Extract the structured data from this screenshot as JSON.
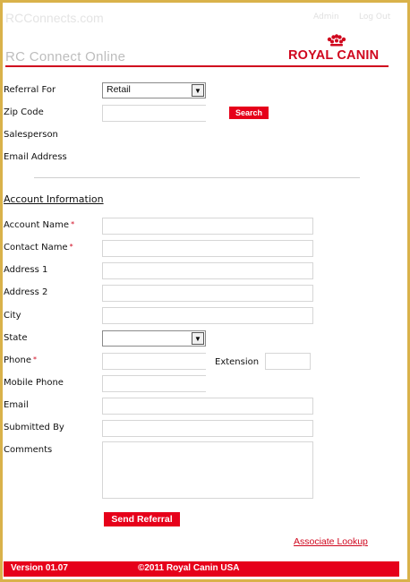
{
  "top": {
    "site_name": "RCConnects.com",
    "links": [
      "Admin",
      "Log Out"
    ]
  },
  "header": {
    "title": "RC Connect Online",
    "logo_text": "ROYAL CANIN"
  },
  "referral": {
    "referral_for_label": "Referral For",
    "referral_for_value": "Retail",
    "zip_label": "Zip Code",
    "zip_value": "",
    "search_button": "Search",
    "salesperson_label": "Salesperson",
    "email_address_label": "Email Address"
  },
  "account": {
    "section_title": "Account Information",
    "required_mark": "*",
    "account_name_label": "Account Name",
    "contact_name_label": "Contact Name",
    "address1_label": "Address 1",
    "address2_label": "Address 2",
    "city_label": "City",
    "state_label": "State",
    "state_value": "",
    "phone_label": "Phone",
    "extension_label": "Extension",
    "mobile_label": "Mobile Phone",
    "email_label": "Email",
    "submitted_by_label": "Submitted By",
    "comments_label": "Comments"
  },
  "actions": {
    "send_referral": "Send Referral",
    "associate_lookup": "Associate Lookup"
  },
  "footer": {
    "version": "Version 01.07",
    "copyright": "©2011 Royal Canin USA"
  },
  "colors": {
    "brand_red": "#d0071e",
    "button_red": "#e6001a",
    "frame_gold": "#d9b24a"
  },
  "icons": [
    "dropdown-arrow-icon",
    "crown-icon"
  ]
}
